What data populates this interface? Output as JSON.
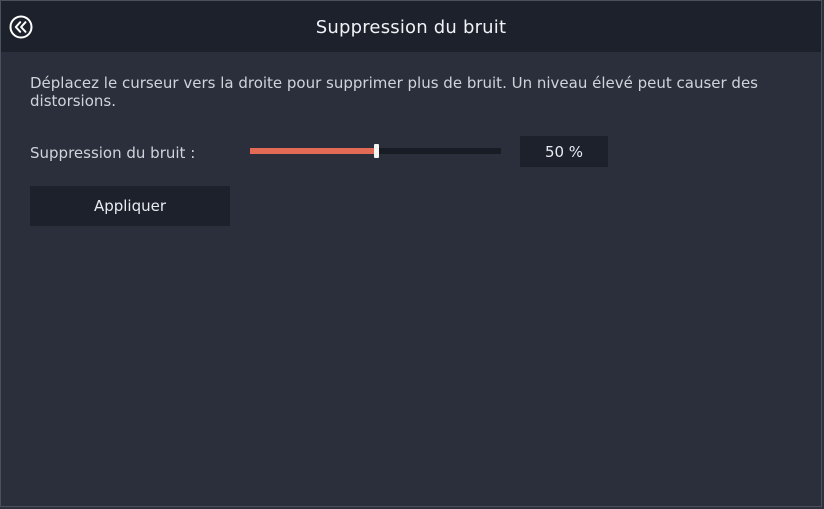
{
  "header": {
    "title": "Suppression du bruit",
    "back_icon": "double-chevron-left-circle-icon"
  },
  "description": "Déplacez le curseur vers la droite pour supprimer plus de bruit. Un niveau élevé peut causer des distorsions.",
  "noise_slider": {
    "label": "Suppression du bruit :",
    "value": 50,
    "value_text": "50 %",
    "fill_color": "#e36a55"
  },
  "apply_button": {
    "label": "Appliquer"
  }
}
